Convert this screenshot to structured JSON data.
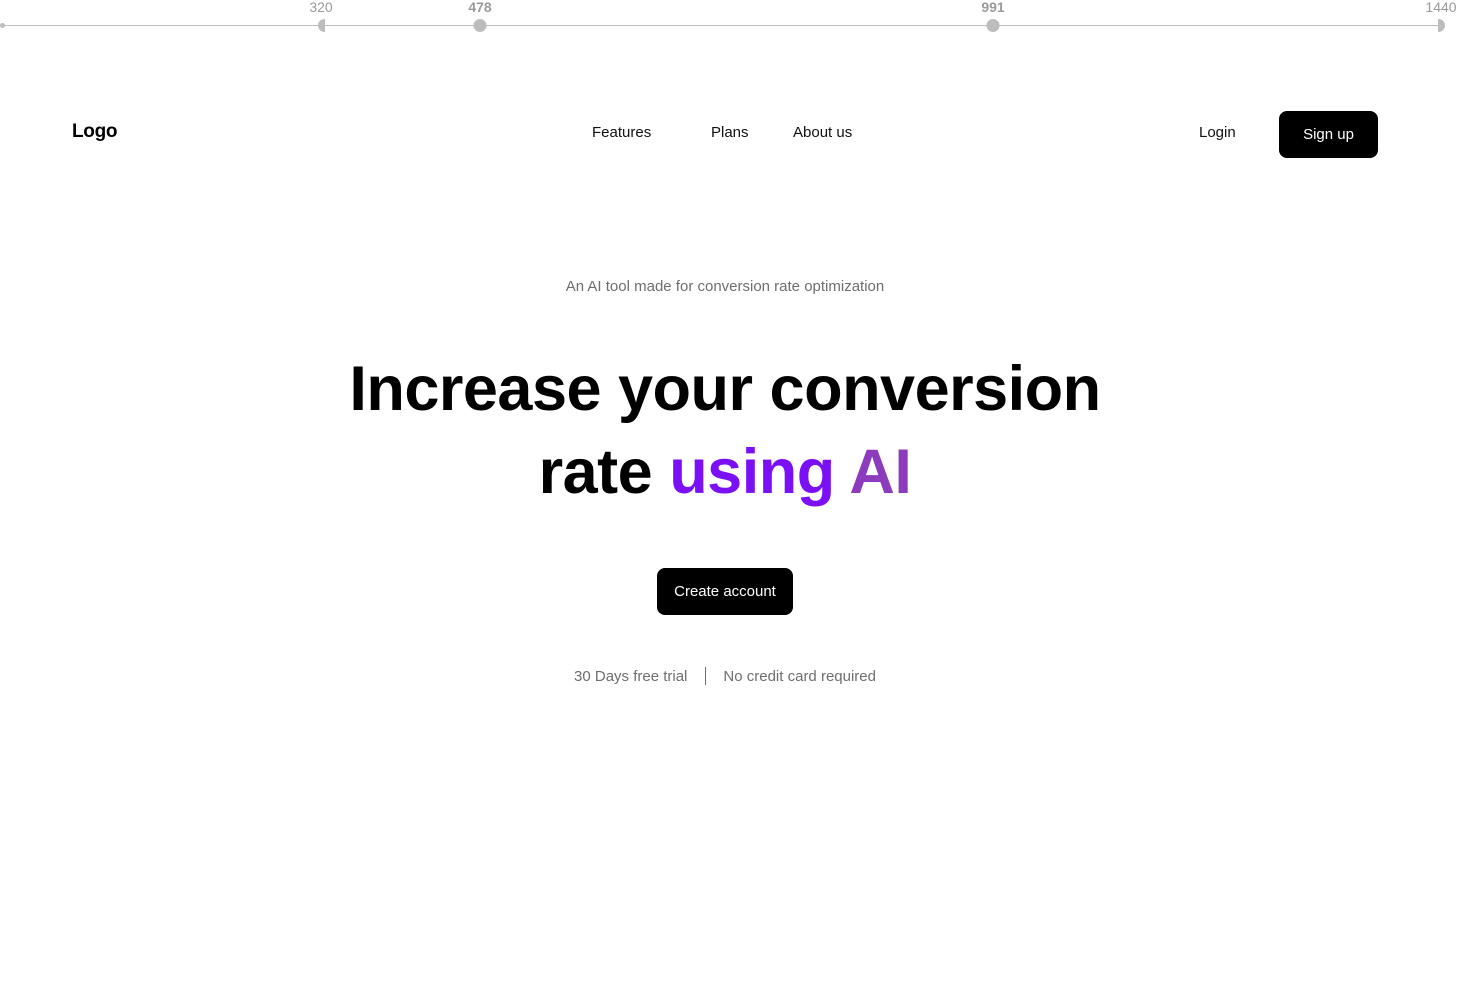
{
  "ruler": {
    "breakpoints": [
      {
        "label": "320",
        "bold": false
      },
      {
        "label": "478",
        "bold": true
      },
      {
        "label": "991",
        "bold": true
      },
      {
        "label": "1440",
        "bold": false
      }
    ],
    "color": "#bdbdbd"
  },
  "navbar": {
    "logo": "Logo",
    "links": {
      "features": "Features",
      "plans": "Plans",
      "about": "About us"
    },
    "login_label": "Login",
    "signup_label": "Sign up"
  },
  "hero": {
    "eyebrow": "An AI tool made for conversion rate optimization",
    "headline_line1": "Increase your conversion",
    "headline_line2_plain": "rate ",
    "headline_accent_1": "using",
    "headline_accent_2": "AI",
    "cta_label": "Create account",
    "perk_1": "30 Days free trial",
    "perk_2": "No credit card required"
  },
  "colors": {
    "text_primary": "#000000",
    "text_muted": "#6e6e6e",
    "accent_purple": "#7b0ff5",
    "accent_violet": "#8d3bbd",
    "button_bg": "#000000",
    "button_text": "#ffffff"
  }
}
